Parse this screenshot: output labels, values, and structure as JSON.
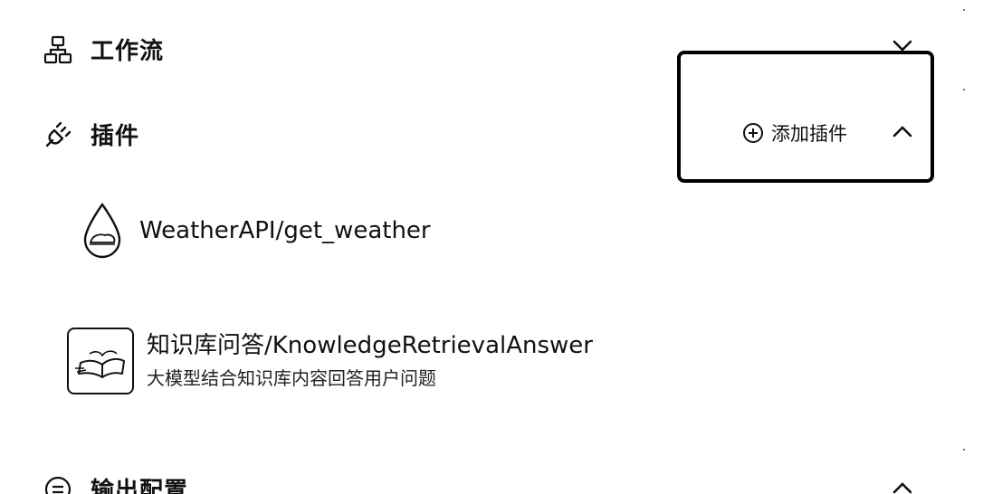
{
  "sections": {
    "workflow": {
      "title": "工作流",
      "icon": "workflow-icon"
    },
    "plugins": {
      "title": "插件",
      "icon": "plug-icon",
      "add_label": "添加插件",
      "items": [
        {
          "name": "WeatherAPI/get_weather",
          "icon": "water-drop-icon"
        },
        {
          "name": "知识库问答/KnowledgeRetrievalAnswer",
          "description": "大模型结合知识库内容回答用户问题",
          "icon": "open-book-icon"
        }
      ]
    },
    "output": {
      "title": "输出配置",
      "icon": "list-circle-icon"
    }
  }
}
